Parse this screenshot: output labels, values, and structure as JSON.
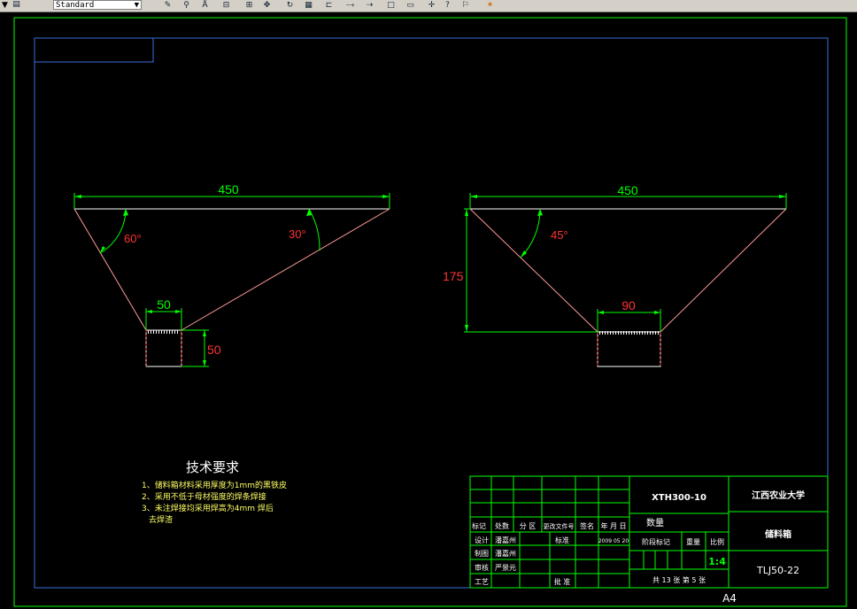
{
  "toolbar": {
    "layer_value": "",
    "style_value": "Standard",
    "icons": [
      "pencil-icon",
      "link-icon",
      "measure-icon",
      "dim-icon",
      "grid-icon",
      "pan-icon",
      "rotate-icon",
      "table-icon",
      "align-icon",
      "dim-linear-icon",
      "dim-aligned-icon",
      "rect-icon",
      "rect2-icon",
      "cross-icon",
      "query-icon",
      "help-icon",
      "star-icon"
    ]
  },
  "colors": {
    "background": "#000000",
    "frame": "#00ff00",
    "inner_border": "#3a6fd8",
    "dimension": "#00ff00",
    "dim_text": "#ff3333",
    "object": "#ffffff",
    "hidden": "#ff3333",
    "text": "#ffff66",
    "table_line": "#00ff00",
    "table_text": "#ffffff"
  },
  "left_view": {
    "top_width": "450",
    "bottom_width": "50",
    "height": "50",
    "angle_left": "60°",
    "angle_right": "30°"
  },
  "right_view": {
    "top_width": "450",
    "bottom_width": "90",
    "height": "175",
    "angle": "45°"
  },
  "notes": {
    "title": "技术要求",
    "items": [
      "1、储料箱材料采用厚度为1mm的黑铁皮",
      "2、采用不低于母材强度的焊条焊接",
      "3、未注焊接均采用焊高为4mm 焊后",
      "去焊渣"
    ]
  },
  "title_block": {
    "drawing_no": "XTH300-10",
    "school": "江西农业大学",
    "part_name": "储料箱",
    "material_code": "TLJ50-22",
    "quantity_label": "数量",
    "stage_label": "阶段标记",
    "weight_label": "重量",
    "scale_label": "比例",
    "scale_value": "1:4",
    "sheet_text": "共 13 张  第 5 张",
    "sheet_size": "A4",
    "header_row": [
      "标记",
      "处数",
      "分 区",
      "更改文件号",
      "签名",
      "年 月 日"
    ],
    "rows": [
      {
        "role": "设计",
        "name": "潘嘉州",
        "role2": "标准",
        "date": "2009 05 20"
      },
      {
        "role": "制图",
        "name": "潘嘉州",
        "role2": "",
        "date": ""
      },
      {
        "role": "审核",
        "name": "严景元",
        "role2": "",
        "date": ""
      },
      {
        "role": "工艺",
        "name": "",
        "role2": "批 准",
        "date": ""
      }
    ]
  }
}
